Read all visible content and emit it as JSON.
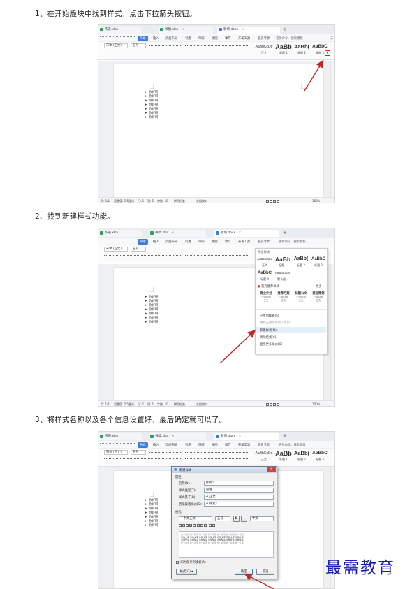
{
  "steps": [
    {
      "text": "1、在开始版块中找到样式，点击下拉箭头按钮。"
    },
    {
      "text": "2、找到新建样式功能。"
    },
    {
      "text": "3、将样式名称以及各个信息设置好，最后确定就可以了。"
    }
  ],
  "window": {
    "tabs": [
      {
        "label": "作表.xlsx",
        "color": "#2e9f5a"
      },
      {
        "label": "书稿.xlsx",
        "color": "#2e9f5a"
      },
      {
        "label": "新增.docx",
        "color": "#3b7ddd"
      }
    ],
    "tab_close": "×",
    "new_tab": "+",
    "menu": [
      "开始",
      "插入",
      "页面布局",
      "引用",
      "审阅",
      "视图",
      "章节",
      "开发工具",
      "会员专享"
    ],
    "menu_more": "›",
    "search_placeholder": "查找命令、搜索模板",
    "right_label": "未",
    "font_name": "宋体 (正文)",
    "font_size": "五号",
    "styles": [
      {
        "sample": "AaBbCcDd",
        "caption": "正文"
      },
      {
        "sample": "AaBb",
        "caption": "标题 1"
      },
      {
        "sample": "AaBb(",
        "caption": "标题 2"
      },
      {
        "sample": "AaBbC",
        "caption": "标题 3"
      }
    ],
    "dropdown_arrow": "▾"
  },
  "document": {
    "bullet_char": "➤",
    "lines": [
      "你好啊",
      "你好啊",
      "你好啊",
      "你好啊",
      "你好啊",
      "你好啊",
      "你好啊"
    ]
  },
  "statusbar": {
    "page": "页: 1/1",
    "position": "设置值: 2.5厘米",
    "row": "行: 1",
    "col": "列: 1",
    "words": "字数: 10",
    "spell": "拼写检查",
    "proof": "文档校对",
    "zoom": "100%"
  },
  "style_menu": {
    "header": "预设样式",
    "samples": [
      {
        "sample": "AaBbCcDd",
        "caption": "正文"
      },
      {
        "sample": "AaBb",
        "caption": "标题 1"
      },
      {
        "sample": "AaBb(",
        "caption": "标题 2"
      },
      {
        "sample": "AaBbC",
        "caption": "标题 3"
      }
    ],
    "samples2": [
      {
        "sample": "AaBbC",
        "caption": "标题 4"
      },
      {
        "sample": "AaBbCcDd",
        "caption": "默认段..."
      }
    ],
    "recommend": "稻壳推荐样式",
    "more": "更多 ›",
    "templates": [
      {
        "title": "商业计划",
        "sub": "一级标题",
        "cap": "正文"
      },
      {
        "title": "推荐方案",
        "sub": "一级标题",
        "cap": "正文"
      },
      {
        "title": "标题公文",
        "sub": "一级标题",
        "cap": "正文"
      },
      {
        "title": "商业策划",
        "sub": "一级标题",
        "cap": "正文"
      }
    ],
    "items": [
      {
        "label": "应用到样式(S)"
      },
      {
        "label": "更新正用样式到工作(T)"
      },
      {
        "label": "新建样式(N)..."
      },
      {
        "label": "清除格式(C)"
      },
      {
        "label": "显示更多样式(O)"
      }
    ]
  },
  "dialog": {
    "title": "新建样式",
    "section_props": "属性",
    "name_label": "名称(N):",
    "name_value": "样式1",
    "type_label": "样式类型(T):",
    "type_value": "段落",
    "base_label": "样式基于(B):",
    "base_value": "↵ 正文",
    "next_label": "后续段落样式(S):",
    "next_value": "↵ 样式1",
    "section_format": "格式",
    "fmt_font": "+中文正文",
    "fmt_size": "五号",
    "fmt_bold": "B",
    "fmt_italic": "I",
    "fmt_lang": "中文",
    "sample_text": "示例文字 示例文字 示例文字 示例文字 示例文字 示例文字 示例文字",
    "sample_prev": "前一段落 前一段落 前一段落 前一段落 前一段落 前一段落 前一段落",
    "checkbox_label": "同时保存到模板(A)",
    "format_button": "格式(O) ▾",
    "ok": "确定",
    "cancel": "取消"
  },
  "watermark": "最需教育",
  "colors": {
    "accent": "#3b7ddd",
    "highlight": "#e0201b",
    "arrow": "#c0282a",
    "watermark": "#1a1ab8"
  }
}
